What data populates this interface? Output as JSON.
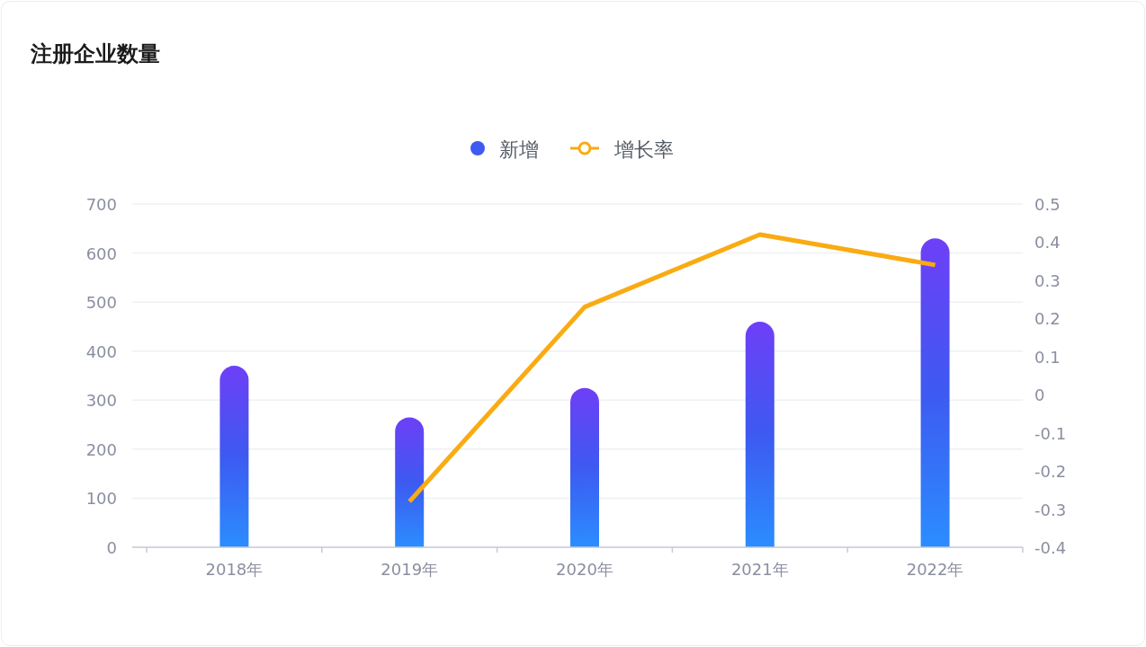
{
  "title": "注册企业数量",
  "chart": {
    "chart_data": {
      "type": "bar",
      "categories": [
        "2018年",
        "2019年",
        "2020年",
        "2021年",
        "2022年"
      ],
      "series": [
        {
          "name": "新增",
          "type": "bar",
          "color": "#3d5af1",
          "values": [
            370,
            265,
            325,
            460,
            630
          ]
        },
        {
          "name": "增长率",
          "type": "line",
          "axis": "y2",
          "color": "#f9ab12",
          "values": [
            null,
            -0.28,
            0.23,
            0.42,
            0.34
          ]
        }
      ],
      "grid": true,
      "legend": true,
      "ylim": [
        0,
        700
      ],
      "yticks": [
        0,
        100,
        200,
        300,
        400,
        500,
        600,
        700
      ],
      "y2lim": [
        -0.4,
        0.5
      ],
      "y2ticks": [
        {
          "value": -0.4,
          "label": "-0.4"
        },
        {
          "value": -0.3,
          "label": "-0.3"
        },
        {
          "value": -0.2,
          "label": "-0.2"
        },
        {
          "value": -0.1,
          "label": "-0.1"
        },
        {
          "value": 0,
          "label": "0"
        },
        {
          "value": 0.1,
          "label": "0.1"
        },
        {
          "value": 0.2,
          "label": "0.2"
        },
        {
          "value": 0.3,
          "label": "0.3"
        },
        {
          "value": 0.4,
          "label": "0.4"
        },
        {
          "value": 0.5,
          "label": "0.5"
        }
      ]
    }
  }
}
